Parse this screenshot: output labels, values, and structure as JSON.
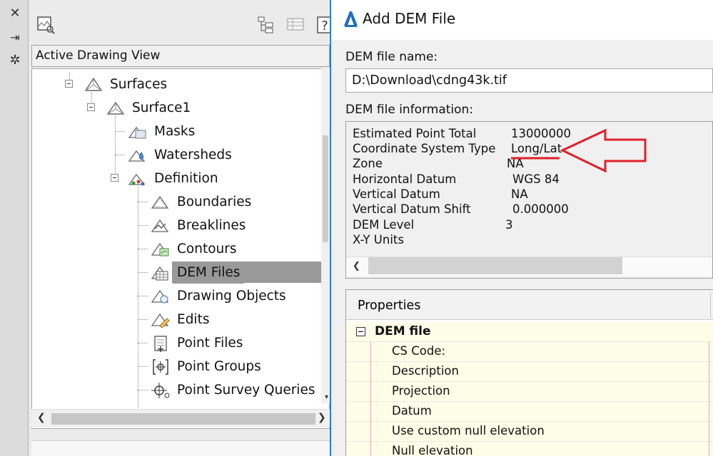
{
  "toolspace": {
    "strip_icons": [
      "close-icon",
      "pin-icon",
      "settings-icon"
    ],
    "active_view": "Active Drawing View",
    "tree": [
      {
        "label": "Surfaces",
        "icon": "surface-group-icon"
      },
      {
        "label": "Surface1",
        "icon": "surface-icon"
      },
      {
        "label": "Masks",
        "icon": "mask-icon"
      },
      {
        "label": "Watersheds",
        "icon": "watershed-icon"
      },
      {
        "label": "Definition",
        "icon": "definition-icon"
      },
      {
        "label": "Boundaries",
        "icon": "boundary-icon"
      },
      {
        "label": "Breaklines",
        "icon": "breakline-icon"
      },
      {
        "label": "Contours",
        "icon": "contour-icon"
      },
      {
        "label": "DEM Files",
        "icon": "dem-file-icon",
        "selected": true
      },
      {
        "label": "Drawing Objects",
        "icon": "drawing-objects-icon"
      },
      {
        "label": "Edits",
        "icon": "edits-icon"
      },
      {
        "label": "Point Files",
        "icon": "point-files-icon"
      },
      {
        "label": "Point Groups",
        "icon": "point-groups-icon"
      },
      {
        "label": "Point Survey Queries",
        "icon": "point-survey-queries-icon"
      }
    ]
  },
  "dialog": {
    "title": "Add DEM File",
    "file_name_label": "DEM file name:",
    "file_name_value": "D:\\Download\\cdng43k.tif",
    "info_label": "DEM file information:",
    "info": [
      {
        "name": "Estimated Point Total",
        "value": "13000000"
      },
      {
        "name": "Coordinate System Type",
        "value": "Long/Lat"
      },
      {
        "name": "Zone",
        "value": "NA"
      },
      {
        "name": "Horizontal Datum",
        "value": "WGS 84"
      },
      {
        "name": "Vertical Datum",
        "value": "NA"
      },
      {
        "name": "Vertical Datum Shift",
        "value": "0.000000"
      },
      {
        "name": "DEM Level",
        "value": "3"
      },
      {
        "name": "X-Y Units",
        "value": ""
      }
    ],
    "properties_header": "Properties",
    "category": "DEM file",
    "properties": [
      "CS Code:",
      "Description",
      "Projection",
      "Datum",
      "Use custom null elevation",
      "Null elevation"
    ]
  },
  "colors": {
    "accent": "#2a7cd3",
    "annotation": "#e0202a",
    "selection": "#999999",
    "property_background": "#fefde7"
  }
}
